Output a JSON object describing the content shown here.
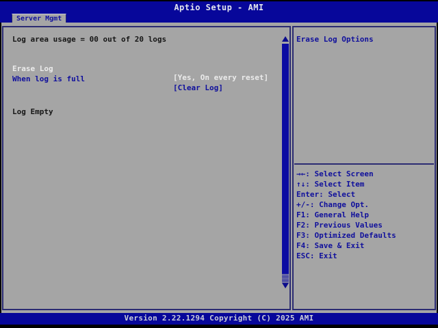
{
  "window": {
    "title": "Aptio Setup - AMI"
  },
  "tabs": [
    {
      "label": "Server Mgmt",
      "active": true
    }
  ],
  "left_panel": {
    "usage_line": "Log area usage = 00 out of 20 logs",
    "options": [
      {
        "label": "Erase Log",
        "value": "[Yes, On every reset]",
        "selected": true
      },
      {
        "label": "When log is full",
        "value": "[Clear Log]",
        "selected": false
      }
    ],
    "status_line": "Log Empty",
    "scrollbar": {
      "up_icon": "up-triangle",
      "down_icon": "down-triangle"
    }
  },
  "right_panel": {
    "help_title": "Erase Log Options",
    "hotkeys": [
      "→←: Select Screen",
      "↑↓: Select Item",
      "Enter: Select",
      "+/-: Change Opt.",
      "F1: General Help",
      "F2: Previous Values",
      "F3: Optimized Defaults",
      "F4: Save & Exit",
      "ESC: Exit"
    ]
  },
  "footer": {
    "version_line": "Version 2.22.1294 Copyright (C) 2025 AMI"
  },
  "colors": {
    "bar_blue": "#07079a",
    "text_blue": "#10109c",
    "border_navy": "#2b2b72",
    "panel_gray": "#a5a5a5",
    "selected_text": "#ebebeb",
    "body_text": "#161616"
  }
}
